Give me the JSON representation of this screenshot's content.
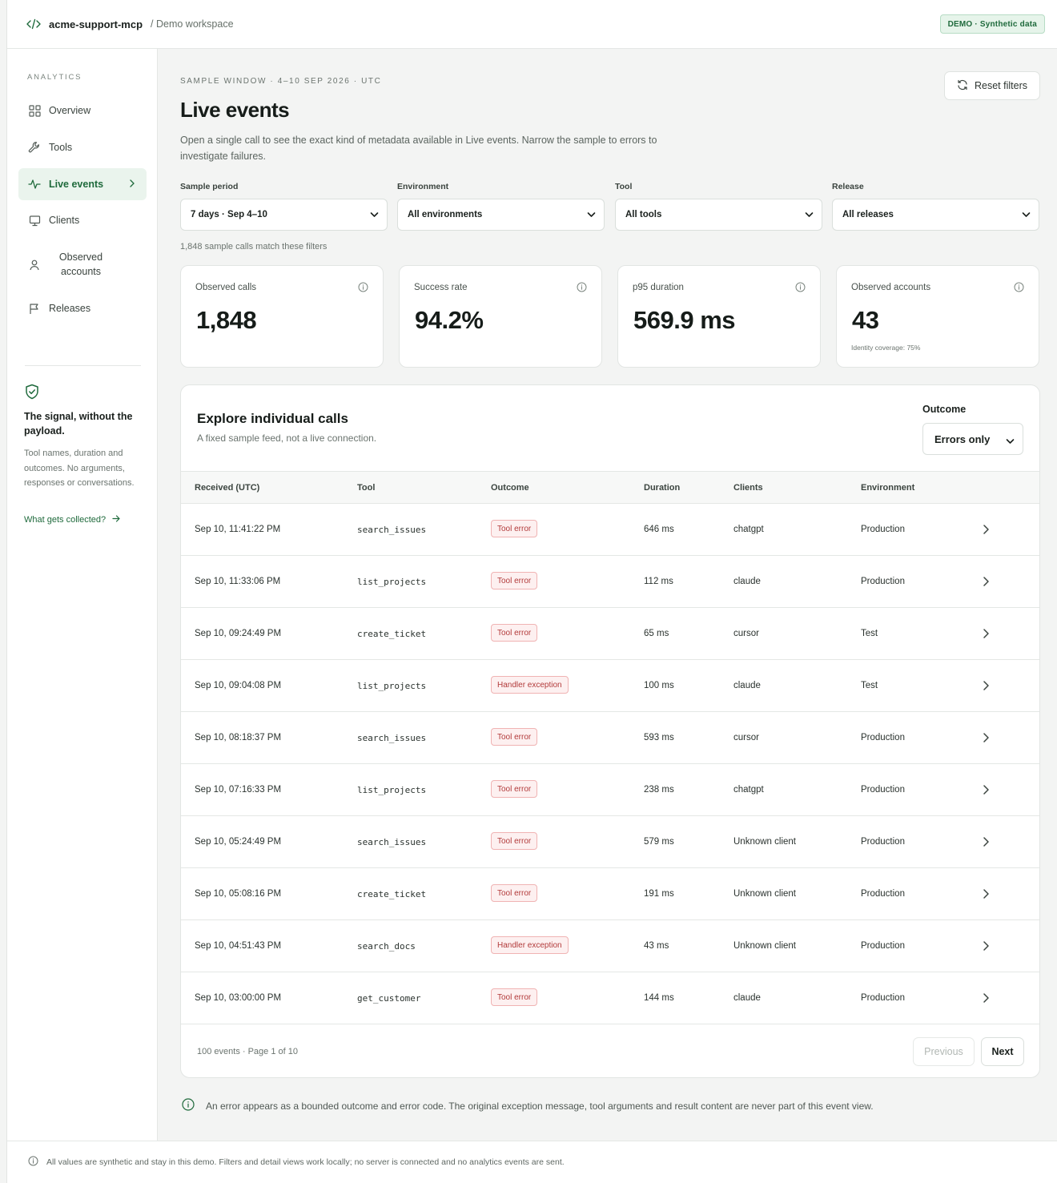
{
  "header": {
    "brand": "acme-support-mcp",
    "workspace": "/ Demo workspace",
    "badge": "DEMO · Synthetic data"
  },
  "sidebar": {
    "heading": "ANALYTICS",
    "items": [
      {
        "label": "Overview",
        "icon": "grid-icon"
      },
      {
        "label": "Tools",
        "icon": "wrench-icon"
      },
      {
        "label": "Live events",
        "icon": "activity-icon",
        "active": true
      },
      {
        "label": "Clients",
        "icon": "monitor-icon"
      },
      {
        "label": "Observed accounts",
        "icon": "user-icon"
      },
      {
        "label": "Releases",
        "icon": "flag-icon"
      }
    ],
    "promo": {
      "title": "The signal, without the payload.",
      "text": "Tool names, duration and outcomes. No arguments, responses or conversations.",
      "link": "What gets collected?"
    }
  },
  "main": {
    "eyebrow": "SAMPLE WINDOW · 4–10 SEP 2026 · UTC",
    "title": "Live events",
    "description": "Open a single call to see the exact kind of metadata available in Live events. Narrow the sample to errors to investigate failures.",
    "reset_label": "Reset filters",
    "filters": [
      {
        "label": "Sample period",
        "value": "7 days · Sep 4–10"
      },
      {
        "label": "Environment",
        "value": "All environments"
      },
      {
        "label": "Tool",
        "value": "All tools"
      },
      {
        "label": "Release",
        "value": "All releases"
      }
    ],
    "match_count": "1,848 sample calls match these filters",
    "stats": [
      {
        "label": "Observed calls",
        "value": "1,848",
        "note": ""
      },
      {
        "label": "Success rate",
        "value": "94.2%",
        "note": ""
      },
      {
        "label": "p95 duration",
        "value": "569.9 ms",
        "note": ""
      },
      {
        "label": "Observed accounts",
        "value": "43",
        "note": "Identity coverage: 75%"
      }
    ]
  },
  "calls": {
    "title": "Explore individual calls",
    "subtitle": "A fixed sample feed, not a live connection.",
    "outcome_label": "Outcome",
    "outcome_value": "Errors only",
    "columns": [
      "Received (UTC)",
      "Tool",
      "Outcome",
      "Duration",
      "Clients",
      "Environment"
    ],
    "rows": [
      {
        "received": "Sep 10, 11:41:22 PM",
        "tool": "search_issues",
        "outcome": "Tool error",
        "duration": "646 ms",
        "client": "chatgpt",
        "env": "Production"
      },
      {
        "received": "Sep 10, 11:33:06 PM",
        "tool": "list_projects",
        "outcome": "Tool error",
        "duration": "112 ms",
        "client": "claude",
        "env": "Production"
      },
      {
        "received": "Sep 10, 09:24:49 PM",
        "tool": "create_ticket",
        "outcome": "Tool error",
        "duration": "65 ms",
        "client": "cursor",
        "env": "Test"
      },
      {
        "received": "Sep 10, 09:04:08 PM",
        "tool": "list_projects",
        "outcome": "Handler exception",
        "duration": "100 ms",
        "client": "claude",
        "env": "Test"
      },
      {
        "received": "Sep 10, 08:18:37 PM",
        "tool": "search_issues",
        "outcome": "Tool error",
        "duration": "593 ms",
        "client": "cursor",
        "env": "Production"
      },
      {
        "received": "Sep 10, 07:16:33 PM",
        "tool": "list_projects",
        "outcome": "Tool error",
        "duration": "238 ms",
        "client": "chatgpt",
        "env": "Production"
      },
      {
        "received": "Sep 10, 05:24:49 PM",
        "tool": "search_issues",
        "outcome": "Tool error",
        "duration": "579 ms",
        "client": "Unknown client",
        "env": "Production"
      },
      {
        "received": "Sep 10, 05:08:16 PM",
        "tool": "create_ticket",
        "outcome": "Tool error",
        "duration": "191 ms",
        "client": "Unknown client",
        "env": "Production"
      },
      {
        "received": "Sep 10, 04:51:43 PM",
        "tool": "search_docs",
        "outcome": "Handler exception",
        "duration": "43 ms",
        "client": "Unknown client",
        "env": "Production"
      },
      {
        "received": "Sep 10, 03:00:00 PM",
        "tool": "get_customer",
        "outcome": "Tool error",
        "duration": "144 ms",
        "client": "claude",
        "env": "Production"
      }
    ],
    "pager_text": "100 events · Page 1 of 10",
    "prev_label": "Previous",
    "next_label": "Next"
  },
  "footnote": "An error appears as a bounded outcome and error code. The original exception message, tool arguments and result content are never part of this event view.",
  "bottom_note": "All values are synthetic and stay in this demo. Filters and detail views work locally; no server is connected and no analytics events are sent.",
  "colors": {
    "accent": "#1f6a3c",
    "error": "#b23a3a"
  }
}
